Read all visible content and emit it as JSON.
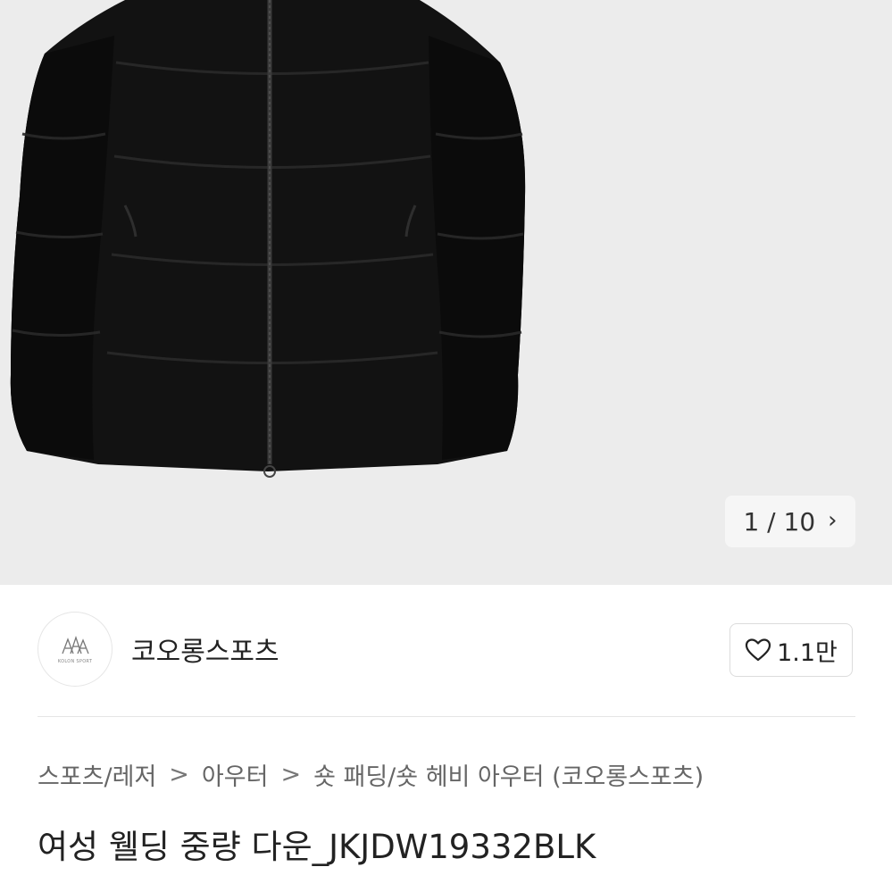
{
  "product_image": {
    "name": "black-down-jacket-image",
    "counter": {
      "current": "1",
      "total": "10",
      "text": "1 / 10"
    }
  },
  "seller": {
    "name": "코오롱스포츠",
    "logo_text": "KOLON SPORT",
    "like_count": "1.1만"
  },
  "breadcrumb": {
    "items": [
      "스포츠/레저",
      "아우터",
      "숏 패딩/숏 헤비 아우터 (코오롱스포츠)"
    ]
  },
  "product": {
    "title": "여성 웰딩 중량 다운_JKJDW19332BLK"
  },
  "colors": {
    "image_bg": "#ececec",
    "jacket": "#111111",
    "text": "#222222",
    "muted": "#666666"
  }
}
